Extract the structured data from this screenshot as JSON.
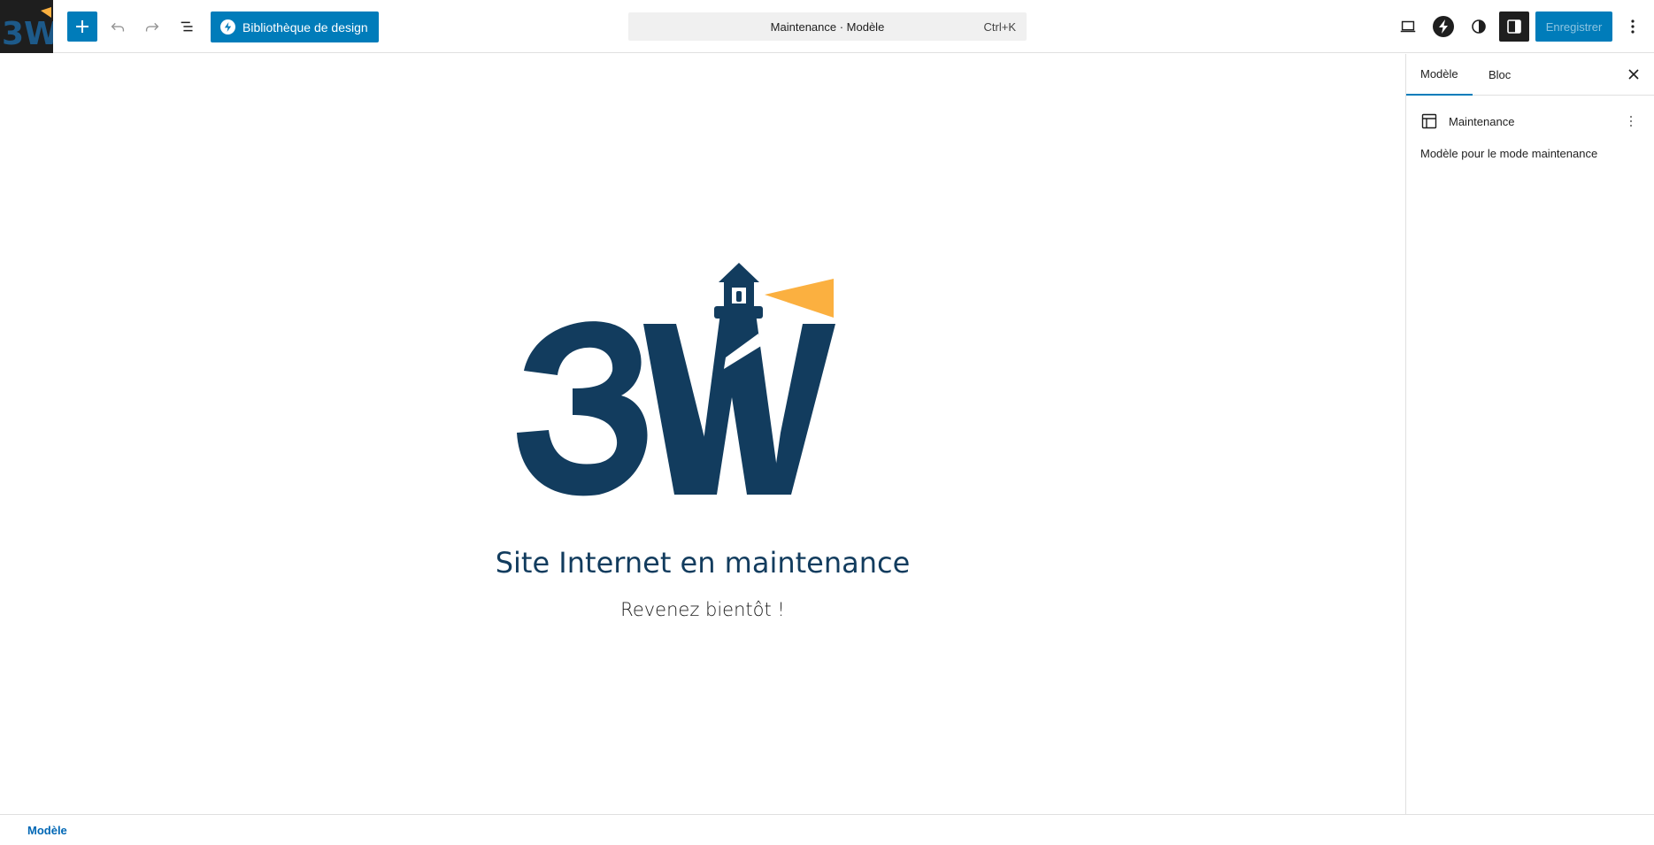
{
  "toolbar": {
    "design_library_label": "Bibliothèque de design",
    "command_title": "Maintenance · Modèle",
    "command_shortcut": "Ctrl+K",
    "save_label": "Enregistrer"
  },
  "icons": {
    "inserter": "plus-icon",
    "undo": "undo-icon",
    "redo": "redo-icon",
    "list_view": "list-view-icon",
    "preview": "laptop-icon",
    "styles": "half-circle-icon",
    "settings": "sidebar-icon",
    "more": "vertical-ellipsis-icon",
    "close": "close-icon",
    "template": "layout-icon"
  },
  "canvas": {
    "heading": "Site Internet en maintenance",
    "tagline": "Revenez bientôt !"
  },
  "sidebar": {
    "tabs": [
      {
        "label": "Modèle",
        "active": true
      },
      {
        "label": "Bloc",
        "active": false
      }
    ],
    "template_name": "Maintenance",
    "template_description": "Modèle pour le mode maintenance"
  },
  "footer": {
    "breadcrumb": "Modèle"
  },
  "colors": {
    "accent": "#007cba",
    "brand_navy": "#123c5e",
    "brand_yellow": "#fbb040"
  }
}
